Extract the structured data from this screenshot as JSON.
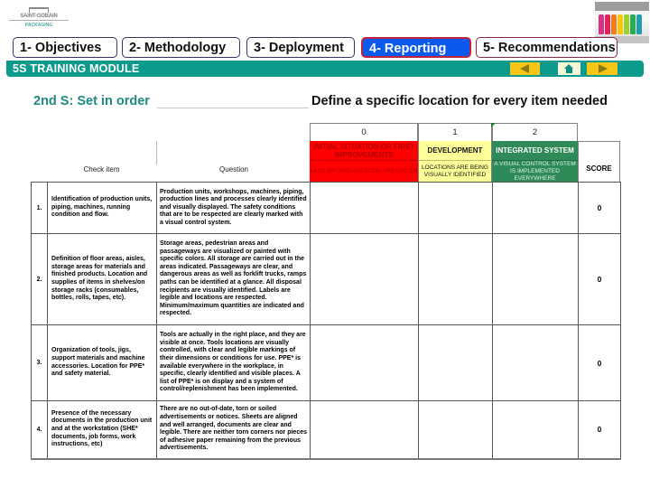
{
  "logo": {
    "brand": "SAINT-GOBAIN",
    "sub": "PACKAGING"
  },
  "bottle_colors": [
    "#d63384",
    "#e0245e",
    "#f07d1a",
    "#f5c518",
    "#9bd12a",
    "#2eab4f",
    "#1f9fb0"
  ],
  "tabs": [
    {
      "label": "1- Objectives",
      "active": false
    },
    {
      "label": "2- Methodology",
      "active": false
    },
    {
      "label": "3- Deployment",
      "active": false
    },
    {
      "label": "4- Reporting",
      "active": true
    },
    {
      "label": "5- Recommendations",
      "active": false
    }
  ],
  "module_bar": {
    "title": "5S TRAINING MODULE",
    "prev_icon": "arrow-left-icon",
    "home_icon": "home-icon",
    "next_icon": "arrow-right-icon"
  },
  "section_title": "2nd S: Set in order",
  "subtitle": "Define a specific location for every item needed",
  "columns": {
    "check_item": "Check item",
    "question": "Question",
    "score": "SCORE"
  },
  "levels": [
    {
      "number": "0",
      "heading": "INITIAL SITUATION OR FIRST IMPROVEMENTS",
      "description": "LACK OF ORGANIZATION AND ORDER",
      "color": "#ff0000"
    },
    {
      "number": "1",
      "heading": "DEVELOPMENT",
      "description": "LOCATIONS ARE BEING VISUALLY IDENTIFIED",
      "color": "#ffff99"
    },
    {
      "number": "2",
      "heading": "INTEGRATED SYSTEM",
      "description": "A VISUAL CONTROL SYSTEM IS IMPLEMENTED EVERYWHERE",
      "color": "#2e8b57"
    }
  ],
  "rows": [
    {
      "num": "1.",
      "item": "Identification of production units, piping, machines, running condition and flow.",
      "question": "Production units, workshops, machines, piping, production lines and processes clearly identified and visually displayed. The safety conditions that are to be respected are clearly marked with a visual control system.",
      "score": "0"
    },
    {
      "num": "2.",
      "item": "Definition of floor areas, aisles, storage areas for materials and finished products. Location and supplies of items in shelves/on storage racks (consumables, bottles, rolls, tapes, etc).",
      "question": "Storage areas, pedestrian areas and passageways are visualized or painted with specific colors. All storage are carried out in the areas indicated. Passageways are clear, and dangerous areas as well as forklift trucks, ramps paths can be identified at a glance. All disposal recipients are visually identified. Labels are legible and locations are respected. Minimum/maximum quantities are indicated and respected.",
      "score": "0"
    },
    {
      "num": "3.",
      "item": "Organization of tools, jigs, support materials and machine accessories. Location for PPE* and safety material.",
      "question": "Tools are actually in the right place, and they are visible at once. Tools locations are visually controlled, with clear and legible markings of their dimensions or conditions for use. PPE* is available everywhere in the workplace, in specific, clearly identified and visible places. A list of PPE* is on display and a system of control/replenishment has been implemented.",
      "score": "0"
    },
    {
      "num": "4.",
      "item": "Presence of the necessary documents in the production unit and at the workstation (SHE* documents, job forms, work instructions, etc)",
      "question": "There are no out-of-date, torn or soiled advertisements or notices. Sheets are aligned and well arranged, documents are clear and legible. There are neither torn corners nor pieces of adhesive paper remaining from the previous advertisements.",
      "score": "0"
    }
  ]
}
